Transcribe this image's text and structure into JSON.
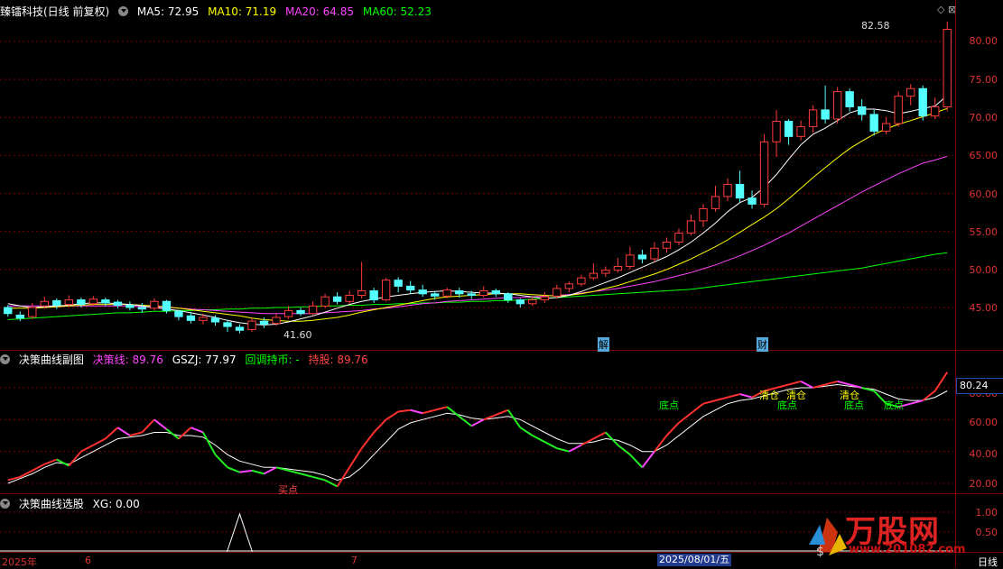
{
  "main_header": {
    "title": "臻镭科技(日线 前复权)",
    "ma5": "MA5: 72.95",
    "ma10": "MA10: 71.19",
    "ma20": "MA20: 64.85",
    "ma60": "MA60: 52.23"
  },
  "main_axis": {
    "ticks": [
      "80.00",
      "75.00",
      "70.00",
      "65.00",
      "60.00",
      "55.00",
      "50.00",
      "45.00"
    ],
    "high_label": "82.58",
    "low_label": "41.60",
    "marker_jie": "解",
    "marker_cai": "财"
  },
  "sub_header": {
    "title": "决策曲线副图",
    "jcx": "决策线: 89.76",
    "gszj": "GSZJ: 77.97",
    "hold": "回调持币: -",
    "hold_val": "持股: 89.76"
  },
  "sub_axis": {
    "ticks": [
      "80.00",
      "60.00",
      "40.00",
      "20.00"
    ],
    "badge": "80.24"
  },
  "sub_signals": [
    "买点",
    "清仓",
    "清仓",
    "清仓",
    "底点",
    "底点",
    "底点",
    "底点"
  ],
  "select_header": {
    "title": "决策曲线选股",
    "xg": "XG: 0.00"
  },
  "select_axis": {
    "ticks": [
      "1.00",
      "0.50"
    ]
  },
  "time_axis": {
    "labels": [
      "2025年",
      "6",
      "7",
      "日线"
    ],
    "current_date": "2025/08/01/五"
  },
  "brand": {
    "name": "万股网",
    "url": "www.201082.com"
  },
  "colors": {
    "up": "#ff3c3c",
    "down": "#54ffff",
    "ma5": "#ffffff",
    "ma10": "#ffff00",
    "ma20": "#ff44ff",
    "ma60": "#00ff00",
    "grid": "#7a0000"
  },
  "chart_data": {
    "type": "candlestick",
    "price_range": [
      40,
      84
    ],
    "candles": [
      [
        45.0,
        44.2,
        45.3,
        43.8
      ],
      [
        44.0,
        43.6,
        44.5,
        43.2
      ],
      [
        43.8,
        45.0,
        45.6,
        43.5
      ],
      [
        45.2,
        45.8,
        46.4,
        44.9
      ],
      [
        45.9,
        45.3,
        46.2,
        44.8
      ],
      [
        45.4,
        46.0,
        46.6,
        45.1
      ],
      [
        46.0,
        45.4,
        46.3,
        45.0
      ],
      [
        45.5,
        46.1,
        46.5,
        45.2
      ],
      [
        46.0,
        45.6,
        46.3,
        45.2
      ],
      [
        45.7,
        45.3,
        46.0,
        44.9
      ],
      [
        45.3,
        45.0,
        45.8,
        44.6
      ],
      [
        45.0,
        44.8,
        45.6,
        44.3
      ],
      [
        44.9,
        45.8,
        46.2,
        44.6
      ],
      [
        45.8,
        44.6,
        46.0,
        44.2
      ],
      [
        44.5,
        43.8,
        44.7,
        43.3
      ],
      [
        43.9,
        43.3,
        44.4,
        42.9
      ],
      [
        43.3,
        43.7,
        44.2,
        42.8
      ],
      [
        43.6,
        43.1,
        44.0,
        42.6
      ],
      [
        43.0,
        42.5,
        43.4,
        41.8
      ],
      [
        42.4,
        42.0,
        42.8,
        41.6
      ],
      [
        42.1,
        43.2,
        43.6,
        41.8
      ],
      [
        43.2,
        42.8,
        43.7,
        42.3
      ],
      [
        42.9,
        43.7,
        44.2,
        42.6
      ],
      [
        43.8,
        44.6,
        45.2,
        43.5
      ],
      [
        44.6,
        44.2,
        45.0,
        43.9
      ],
      [
        44.2,
        45.2,
        45.8,
        44.0
      ],
      [
        45.2,
        46.4,
        46.8,
        44.9
      ],
      [
        46.4,
        45.8,
        47.0,
        45.4
      ],
      [
        45.8,
        46.6,
        47.2,
        45.5
      ],
      [
        46.6,
        47.2,
        51.0,
        46.2
      ],
      [
        47.2,
        46.0,
        47.6,
        45.6
      ],
      [
        46.0,
        48.6,
        48.9,
        45.8
      ],
      [
        48.6,
        47.8,
        49.0,
        47.0
      ],
      [
        47.8,
        47.3,
        48.5,
        46.8
      ],
      [
        47.3,
        46.8,
        48.0,
        46.4
      ],
      [
        46.8,
        46.5,
        47.2,
        46.0
      ],
      [
        46.5,
        47.3,
        47.6,
        46.2
      ],
      [
        47.2,
        46.8,
        47.6,
        46.3
      ],
      [
        46.8,
        46.6,
        47.2,
        46.1
      ],
      [
        46.6,
        47.2,
        47.8,
        46.3
      ],
      [
        47.2,
        46.8,
        47.5,
        46.4
      ],
      [
        46.8,
        46.0,
        47.0,
        45.6
      ],
      [
        46.0,
        45.5,
        46.2,
        45.0
      ],
      [
        45.5,
        46.0,
        46.4,
        45.2
      ],
      [
        46.0,
        46.4,
        47.0,
        45.6
      ],
      [
        46.5,
        47.5,
        48.0,
        46.2
      ],
      [
        47.5,
        48.1,
        48.4,
        47.0
      ],
      [
        48.1,
        48.9,
        49.3,
        47.8
      ],
      [
        48.9,
        49.5,
        50.8,
        48.6
      ],
      [
        49.5,
        49.9,
        50.4,
        49.0
      ],
      [
        49.9,
        50.4,
        51.5,
        49.6
      ],
      [
        50.4,
        51.9,
        53.0,
        50.0
      ],
      [
        51.9,
        51.4,
        52.6,
        50.8
      ],
      [
        51.4,
        52.8,
        53.6,
        51.0
      ],
      [
        52.8,
        53.6,
        54.2,
        52.2
      ],
      [
        53.6,
        54.8,
        55.4,
        53.2
      ],
      [
        54.8,
        56.4,
        57.2,
        54.5
      ],
      [
        56.4,
        58.0,
        58.6,
        55.6
      ],
      [
        58.0,
        59.6,
        61.0,
        57.6
      ],
      [
        59.6,
        61.2,
        62.0,
        59.0
      ],
      [
        61.2,
        59.4,
        63.0,
        58.8
      ],
      [
        59.4,
        58.6,
        60.4,
        58.0
      ],
      [
        58.6,
        66.8,
        67.8,
        58.2
      ],
      [
        66.8,
        69.5,
        71.0,
        64.8
      ],
      [
        69.5,
        67.5,
        69.8,
        66.4
      ],
      [
        67.5,
        68.8,
        69.6,
        67.0
      ],
      [
        68.8,
        71.0,
        71.6,
        68.0
      ],
      [
        71.0,
        69.8,
        74.2,
        69.2
      ],
      [
        69.8,
        73.4,
        74.0,
        69.2
      ],
      [
        73.4,
        71.4,
        73.8,
        70.8
      ],
      [
        71.4,
        70.4,
        72.4,
        69.6
      ],
      [
        70.4,
        68.2,
        71.0,
        67.6
      ],
      [
        68.2,
        69.2,
        70.0,
        67.8
      ],
      [
        69.2,
        72.8,
        73.4,
        68.8
      ],
      [
        72.8,
        73.8,
        74.4,
        71.6
      ],
      [
        73.8,
        70.2,
        74.2,
        69.6
      ],
      [
        70.2,
        71.4,
        72.6,
        69.8
      ],
      [
        71.4,
        81.6,
        82.6,
        70.8
      ]
    ],
    "ma5": [
      45.5,
      45.2,
      45.0,
      45.1,
      45.2,
      45.3,
      45.5,
      45.6,
      45.6,
      45.5,
      45.4,
      45.2,
      45.0,
      44.8,
      44.6,
      44.3,
      44.0,
      43.7,
      43.3,
      43.0,
      42.8,
      42.7,
      42.8,
      43.1,
      43.5,
      43.9,
      44.4,
      44.9,
      45.4,
      45.8,
      46.1,
      46.4,
      46.6,
      46.8,
      47.0,
      47.1,
      47.2,
      47.1,
      47.0,
      46.9,
      46.9,
      46.8,
      46.6,
      46.4,
      46.2,
      46.3,
      46.6,
      47.1,
      47.7,
      48.3,
      48.9,
      49.6,
      50.3,
      51.0,
      51.7,
      52.6,
      53.6,
      54.8,
      56.1,
      57.6,
      58.8,
      59.5,
      60.8,
      62.5,
      64.5,
      66.4,
      67.8,
      68.6,
      69.6,
      70.6,
      71.1,
      71.1,
      70.9,
      70.5,
      70.8,
      71.2,
      71.5,
      72.9
    ],
    "ma10": [
      44.9,
      44.9,
      44.9,
      45.0,
      45.1,
      45.2,
      45.3,
      45.4,
      45.4,
      45.4,
      45.4,
      45.3,
      45.2,
      45.1,
      44.9,
      44.7,
      44.5,
      44.3,
      44.1,
      43.9,
      43.6,
      43.4,
      43.3,
      43.2,
      43.2,
      43.3,
      43.5,
      43.7,
      44.0,
      44.4,
      44.7,
      45.0,
      45.3,
      45.6,
      45.9,
      46.2,
      46.4,
      46.5,
      46.6,
      46.7,
      46.8,
      46.8,
      46.8,
      46.7,
      46.6,
      46.5,
      46.6,
      46.8,
      47.1,
      47.5,
      47.9,
      48.4,
      48.9,
      49.4,
      50.0,
      50.7,
      51.4,
      52.2,
      53.0,
      53.9,
      54.9,
      55.9,
      56.9,
      58.0,
      59.3,
      60.7,
      62.1,
      63.4,
      64.7,
      65.9,
      66.9,
      67.8,
      68.5,
      69.1,
      69.6,
      70.1,
      70.6,
      71.2
    ],
    "ma20": [
      45.2,
      45.2,
      45.2,
      45.2,
      45.2,
      45.2,
      45.2,
      45.2,
      45.2,
      45.2,
      45.2,
      45.1,
      45.1,
      45.0,
      44.9,
      44.8,
      44.7,
      44.6,
      44.5,
      44.4,
      44.3,
      44.2,
      44.2,
      44.2,
      44.2,
      44.2,
      44.3,
      44.4,
      44.5,
      44.6,
      44.8,
      44.9,
      45.1,
      45.3,
      45.5,
      45.6,
      45.8,
      45.9,
      46.0,
      46.1,
      46.2,
      46.3,
      46.3,
      46.4,
      46.5,
      46.6,
      46.7,
      46.9,
      47.1,
      47.3,
      47.5,
      47.8,
      48.1,
      48.4,
      48.8,
      49.2,
      49.6,
      50.1,
      50.6,
      51.2,
      51.8,
      52.5,
      53.2,
      54.0,
      54.8,
      55.7,
      56.6,
      57.5,
      58.4,
      59.3,
      60.2,
      61.0,
      61.8,
      62.6,
      63.3,
      64.0,
      64.4,
      64.9
    ],
    "ma60": [
      43.4,
      43.5,
      43.6,
      43.7,
      43.8,
      43.9,
      44.0,
      44.1,
      44.2,
      44.3,
      44.3,
      44.4,
      44.5,
      44.5,
      44.6,
      44.6,
      44.7,
      44.7,
      44.8,
      44.8,
      44.9,
      44.9,
      45.0,
      45.0,
      45.1,
      45.1,
      45.2,
      45.2,
      45.3,
      45.3,
      45.4,
      45.4,
      45.5,
      45.5,
      45.6,
      45.6,
      45.7,
      45.7,
      45.8,
      45.8,
      45.9,
      45.9,
      46.0,
      46.1,
      46.2,
      46.3,
      46.4,
      46.5,
      46.6,
      46.7,
      46.8,
      46.9,
      47.0,
      47.1,
      47.2,
      47.3,
      47.4,
      47.6,
      47.8,
      48.0,
      48.2,
      48.4,
      48.6,
      48.8,
      49.0,
      49.2,
      49.4,
      49.6,
      49.8,
      50.0,
      50.2,
      50.5,
      50.8,
      51.1,
      51.4,
      51.7,
      52.0,
      52.2
    ],
    "sub_range": [
      13,
      96
    ],
    "jcx": [
      22,
      24,
      28,
      32,
      35,
      31,
      40,
      44,
      48,
      55,
      50,
      52,
      60,
      54,
      48,
      55,
      52,
      38,
      30,
      27,
      28,
      26,
      30,
      28,
      26,
      24,
      22,
      18,
      30,
      42,
      52,
      60,
      65,
      66,
      64,
      66,
      68,
      62,
      56,
      60,
      63,
      66,
      55,
      50,
      46,
      42,
      40,
      44,
      48,
      52,
      44,
      38,
      30,
      40,
      50,
      58,
      64,
      70,
      72,
      74,
      76,
      74,
      78,
      80,
      82,
      84,
      80,
      82,
      84,
      82,
      80,
      78,
      70,
      68,
      70,
      72,
      78,
      89.8
    ],
    "gszj": [
      20,
      23,
      26,
      30,
      33,
      32,
      36,
      40,
      44,
      48,
      49,
      50,
      52,
      52,
      50,
      50,
      49,
      44,
      38,
      34,
      32,
      30,
      30,
      29,
      28,
      27,
      25,
      22,
      24,
      30,
      38,
      46,
      54,
      58,
      60,
      62,
      64,
      63,
      61,
      60,
      61,
      62,
      60,
      56,
      52,
      48,
      45,
      45,
      46,
      48,
      47,
      44,
      40,
      40,
      44,
      50,
      56,
      62,
      66,
      70,
      72,
      73,
      75,
      77,
      79,
      80,
      80,
      81,
      82,
      81,
      80,
      79,
      76,
      73,
      72,
      72,
      74,
      78
    ]
  }
}
